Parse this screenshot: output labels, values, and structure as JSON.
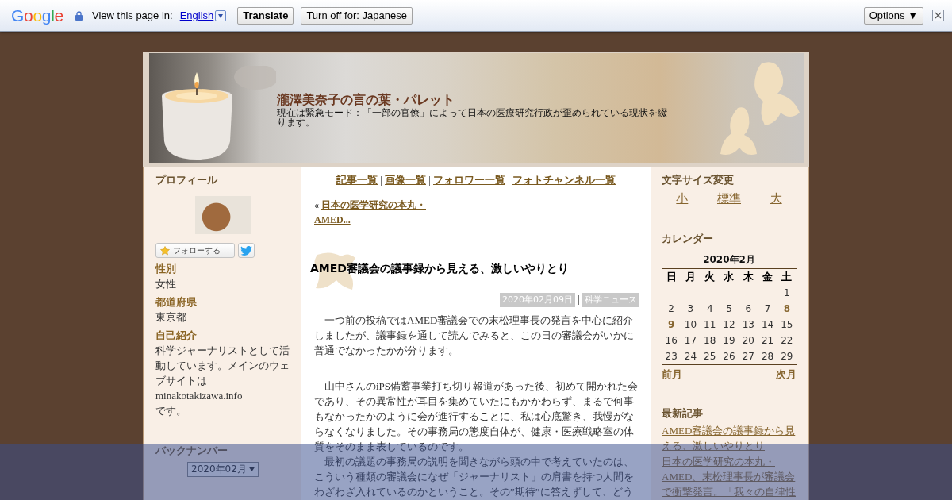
{
  "translate_bar": {
    "logo": "Google",
    "prompt": "View this page in:",
    "language": "English",
    "translate_button": "Translate",
    "turn_off_button": "Turn off for: Japanese",
    "options_button": "Options ▼"
  },
  "header": {
    "title": "瀧澤美奈子の言の葉・パレット",
    "description": "現在は緊急モード：「一部の官僚」によって日本の医療研究行政が歪められている現状を綴ります。"
  },
  "left_sidebar": {
    "profile_heading": "プロフィール",
    "follow_button": "フォローする",
    "fields": [
      {
        "label": "性別",
        "lines": [
          "女性"
        ]
      },
      {
        "label": "都道府県",
        "lines": [
          "東京都"
        ]
      },
      {
        "label": "自己紹介",
        "lines": [
          "科学ジャーナリストとして活動しています。メインのウェブサイトは",
          "minakotakizawa.info",
          "です。"
        ]
      }
    ],
    "backnumber_heading": "バックナンバー",
    "backnumber_select": "2020年02月"
  },
  "main": {
    "nav_links": [
      "記事一覧",
      "画像一覧",
      "フォロワー一覧",
      "フォトチャンネル一覧"
    ],
    "prev_marker": "«",
    "prev_link": "日本の医学研究の本丸・AMED...",
    "article": {
      "title": "AMED審議会の議事録から見える、激しいやりとり",
      "date": "2020年02月09日",
      "category": "科学ニュース",
      "paragraphs": [
        "一つ前の投稿ではAMED審議会での末松理事長の発言を中心に紹介しましたが、議事録を通して読んでみると、この日の審議会がいかに普通でなかったかが分ります。",
        "山中さんのiPS備蓄事業打ち切り報道があった後、初めて開かれた会であり、その異常性が耳目を集めていたにもかかわらず、まるで何事もなかったかのように会が進行することに、私は心底驚き、我慢がならなくなりました。その事務局の態度自体が、健康・医療戦略室の体質をそのまま表しているのです。",
        "最初の議題の事務局の説明を聞きながら頭の中で考えていたのは、こういう種類の審議会になぜ「ジャーナリスト」の肩書を持つ人間をわざわざ入れているのかということ。その”期待”に答えずして、どう"
      ]
    }
  },
  "right_sidebar": {
    "font_size_heading": "文字サイズ変更",
    "font_sizes": [
      "小",
      "標準",
      "大"
    ],
    "calendar": {
      "heading": "カレンダー",
      "month": "2020年2月",
      "weekdays": [
        "日",
        "月",
        "火",
        "水",
        "木",
        "金",
        "土"
      ],
      "days": [
        {
          "label": "1",
          "linked": false
        },
        {
          "label": "2",
          "linked": false
        },
        {
          "label": "3",
          "linked": false
        },
        {
          "label": "4",
          "linked": false
        },
        {
          "label": "5",
          "linked": false
        },
        {
          "label": "6",
          "linked": false
        },
        {
          "label": "7",
          "linked": false
        },
        {
          "label": "8",
          "linked": true
        },
        {
          "label": "9",
          "linked": true
        },
        {
          "label": "10",
          "linked": false
        },
        {
          "label": "11",
          "linked": false
        },
        {
          "label": "12",
          "linked": false
        },
        {
          "label": "13",
          "linked": false
        },
        {
          "label": "14",
          "linked": false
        },
        {
          "label": "15",
          "linked": false
        },
        {
          "label": "16",
          "linked": false
        },
        {
          "label": "17",
          "linked": false
        },
        {
          "label": "18",
          "linked": false
        },
        {
          "label": "19",
          "linked": false
        },
        {
          "label": "20",
          "linked": false
        },
        {
          "label": "21",
          "linked": false
        },
        {
          "label": "22",
          "linked": false
        },
        {
          "label": "23",
          "linked": false
        },
        {
          "label": "24",
          "linked": false
        },
        {
          "label": "25",
          "linked": false
        },
        {
          "label": "26",
          "linked": false
        },
        {
          "label": "27",
          "linked": false
        },
        {
          "label": "28",
          "linked": false
        },
        {
          "label": "29",
          "linked": false
        }
      ],
      "prev_month": "前月",
      "next_month": "次月"
    },
    "recent_heading": "最新記事",
    "recent_posts": [
      "AMED審議会の議事録から見える、激しいやりとり",
      "日本の医学研究の本丸・AMED、末松理事長が審議会で衝撃発言。「我々の自律性"
    ]
  }
}
